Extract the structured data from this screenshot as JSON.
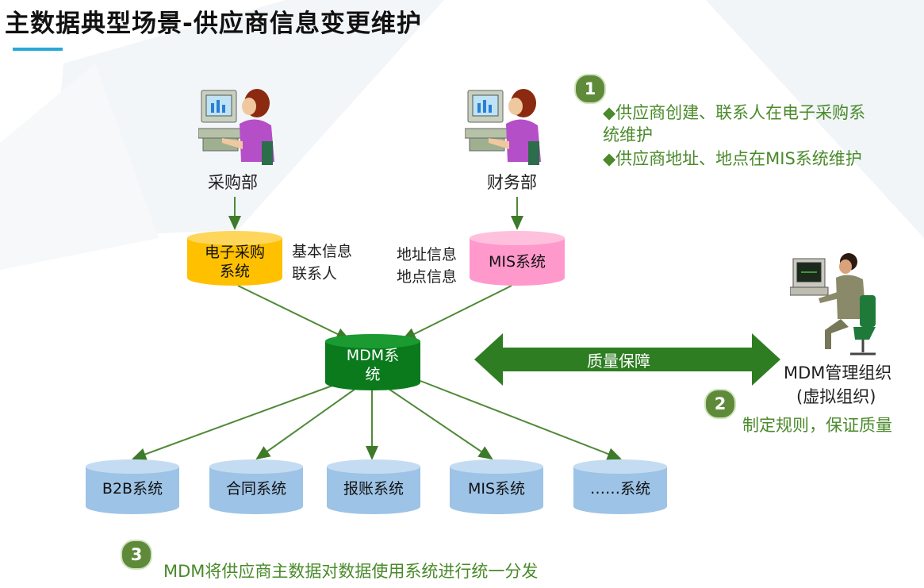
{
  "title": "主数据典型场景-供应商信息变更维护",
  "people": {
    "purchasing": "采购部",
    "finance": "财务部",
    "mdm_org_line1": "MDM管理组织",
    "mdm_org_line2": "(虚拟组织)"
  },
  "systems": {
    "ecommerce_line1": "电子采购",
    "ecommerce_line2": "系统",
    "mis_top": "MIS系统",
    "mdm_line1": "MDM系",
    "mdm_line2": "统"
  },
  "side_labels": {
    "basic_info": "基本信息",
    "contacts": "联系人",
    "address_info": "地址信息",
    "location_info": "地点信息"
  },
  "quality_arrow_label": "质量保障",
  "downstream": [
    "B2B系统",
    "合同系统",
    "报账系统",
    "MIS系统",
    "……系统"
  ],
  "notes": {
    "n1_badge": "1",
    "n1_line1": "◆供应商创建、联系人在电子采购系",
    "n1_line2": "统维护",
    "n1_line3": "◆供应商地址、地点在MIS系统维护",
    "n2_badge": "2",
    "n2_text": "制定规则，保证质量",
    "n3_badge": "3",
    "n3_text": "MDM将供应商主数据对数据使用系统进行统一分发"
  },
  "colors": {
    "ecommerce": "#ffc000",
    "mis_top": "#ff99cc",
    "mdm": "#0a7a1c",
    "downstream": "#9dc3e6",
    "arrow": "#2e7d22",
    "badge": "#5e8a3a"
  }
}
